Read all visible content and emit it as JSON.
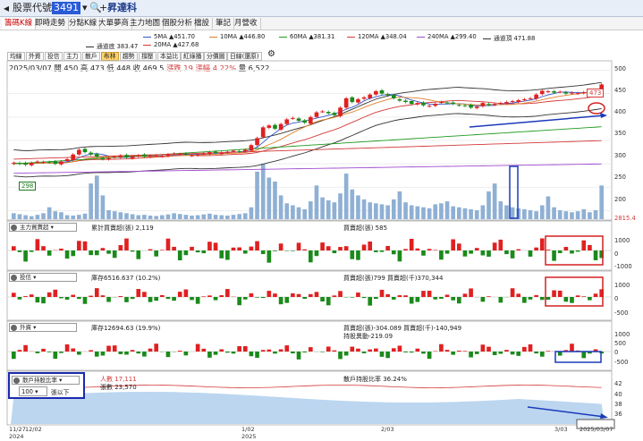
{
  "app": {
    "label": "股票代號",
    "code": "3491",
    "name": "昇達科"
  },
  "tabs": [
    "籌碼K線",
    "即時走勢",
    "分點K線",
    "大單夢商",
    "主力地圖",
    "個股分析",
    "檔設",
    "筆記",
    "月營收"
  ],
  "ma_legend": [
    {
      "label": "5MA ▲451.70",
      "color": "#3355cc"
    },
    {
      "label": "10MA ▲446.80",
      "color": "#e0802a"
    },
    {
      "label": "60MA ▲381.31",
      "color": "#1e9a1e"
    },
    {
      "label": "120MA ▲348.04",
      "color": "#d43a3a"
    },
    {
      "label": "240MA ▲299.40",
      "color": "#a04bd0"
    },
    {
      "label": "通道頂 471.88",
      "color": "#333333"
    },
    {
      "label": "通道底 383.47",
      "color": "#333333"
    },
    {
      "label": "20MA ▲427.68",
      "color": "#d43a3a"
    }
  ],
  "toolbar": [
    "均線",
    "外資",
    "投信",
    "主力",
    "散戶",
    "布林",
    "趨勢",
    "撐壓",
    "本益比",
    "紅綠播",
    "分價圖",
    "日線(還原)"
  ],
  "ohlc": {
    "date": "2025/03/07",
    "open": "開 450",
    "high": "高 473",
    "low": "低 448",
    "close": "收 469.5",
    "change": "漲跌 19",
    "pct": "漲幅 4.22%",
    "vol": "量 6,522"
  },
  "price_labels": {
    "max": "473",
    "min": "298"
  },
  "main_axis": [
    "500",
    "450",
    "400",
    "350",
    "300",
    "250",
    "200"
  ],
  "vol_right": "2815.4",
  "panels": {
    "p1": {
      "name": "主力買賣超",
      "cum": "累計買賣超(張) 2,119",
      "daily": "買賣超(張) 585",
      "axis": [
        "1000",
        "0",
        "-1000"
      ]
    },
    "p2": {
      "name": "投信",
      "hold": "庫存6516.637 (10.2%)",
      "daily": "買賣超(張)799 買賣超(千)370,344",
      "axis": [
        "1000",
        "0",
        "-500"
      ]
    },
    "p3": {
      "name": "外資",
      "hold": "庫存12694.63 (19.9%)",
      "daily": "買賣超(張)-304.089 買賣超(千)-140,949",
      "extra": "持股異動-219.09",
      "axis": [
        "1000",
        "500",
        "0",
        "-500"
      ]
    },
    "p4": {
      "name": "散戶持股比率",
      "sel": "100",
      "selsuffix": "張以下",
      "people": "人數 17,111",
      "shares": "張數 23,570",
      "ratio": "散戶持股比率 36.24%",
      "axis": [
        "42",
        "40",
        "38",
        "36"
      ]
    }
  },
  "dates": [
    {
      "t": "11/27",
      "x": 10,
      "y": 476
    },
    {
      "t": "2024",
      "x": 10,
      "y": 484
    },
    {
      "t": "12/02",
      "x": 28,
      "y": 476
    },
    {
      "t": "1/02",
      "x": 270,
      "y": 476
    },
    {
      "t": "2025",
      "x": 270,
      "y": 484
    },
    {
      "t": "2/03",
      "x": 426,
      "y": 476
    },
    {
      "t": "3/03",
      "x": 620,
      "y": 476
    },
    {
      "t": "2025/03/07",
      "x": 648,
      "y": 476
    }
  ],
  "chart_data": {
    "type": "candlestick",
    "close": [
      302,
      300,
      298,
      302,
      305,
      304,
      303,
      300,
      305,
      310,
      320,
      330,
      325,
      320,
      315,
      310,
      312,
      315,
      318,
      314,
      316,
      318,
      316,
      317,
      318,
      317,
      320,
      322,
      321,
      320,
      318,
      320,
      322,
      325,
      323,
      324,
      326,
      328,
      326,
      330,
      340,
      355,
      378,
      382,
      375,
      385,
      395,
      398,
      392,
      388,
      400,
      410,
      412,
      408,
      404,
      420,
      440,
      432,
      438,
      442,
      448,
      455,
      450,
      446,
      440,
      435,
      432,
      428,
      430,
      425,
      424,
      428,
      432,
      430,
      428,
      425,
      424,
      420,
      422,
      430,
      426,
      428,
      430,
      432,
      434,
      436,
      438,
      440,
      448,
      456,
      455,
      452,
      454,
      450,
      452,
      451,
      453,
      455,
      458,
      469.5
    ],
    "volume": [
      30,
      25,
      20,
      15,
      22,
      30,
      60,
      40,
      35,
      20,
      18,
      22,
      28,
      180,
      220,
      120,
      45,
      40,
      35,
      30,
      25,
      20,
      22,
      18,
      16,
      20,
      24,
      30,
      26,
      22,
      18,
      20,
      24,
      28,
      22,
      20,
      18,
      22,
      26,
      30,
      60,
      240,
      280,
      210,
      190,
      120,
      80,
      70,
      60,
      50,
      90,
      170,
      110,
      95,
      85,
      130,
      230,
      150,
      120,
      100,
      85,
      80,
      75,
      70,
      100,
      140,
      85,
      70,
      65,
      60,
      55,
      75,
      80,
      90,
      65,
      60,
      55,
      50,
      45,
      70,
      140,
      180,
      90,
      70,
      60,
      55,
      50,
      45,
      40,
      70,
      115,
      60,
      45,
      40,
      35,
      40,
      50,
      35,
      45,
      170
    ],
    "ylim": [
      180,
      520
    ]
  }
}
